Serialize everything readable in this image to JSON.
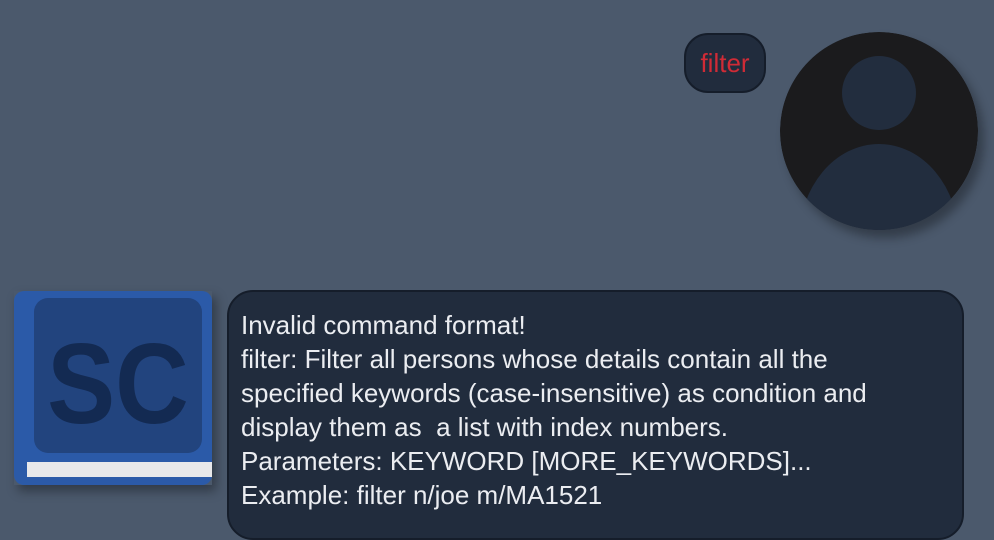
{
  "user_message": {
    "text": "filter",
    "text_color": "#d02b36",
    "avatar_icon": "user-silhouette-icon"
  },
  "bot_message": {
    "avatar_icon": "sc-book-icon",
    "avatar_letters": "SC",
    "lines": [
      "Invalid command format!",
      "filter: Filter all persons whose details contain all the",
      "specified keywords (case-insensitive) as condition and",
      "display them as  a list with index numbers.",
      "Parameters: KEYWORD [MORE_KEYWORDS]...",
      "Example: filter n/joe m/MA1521"
    ]
  },
  "colors": {
    "background": "#4b596c",
    "bubble": "#212c3d",
    "bubble_border": "#151d2a",
    "text": "#ebedf1",
    "book_blue": "#2b5aa8"
  }
}
